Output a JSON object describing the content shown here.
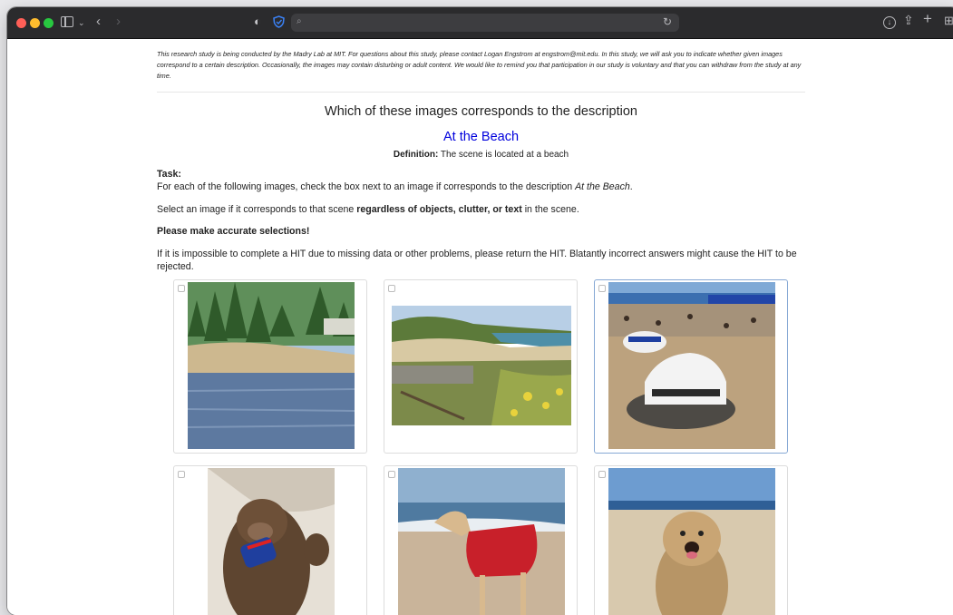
{
  "disclaimer": "This research study is being conducted by the Madry Lab at MIT. For questions about this study, please contact Logan Engstrom at engstrom@mit.edu. In this study, we will ask you to indicate whether given images correspond to a certain description. Occasionally, the images may contain disturbing or adult content. We would like to remind you that participation in our study is voluntary and that you can withdraw from the study at any time.",
  "question": "Which of these images corresponds to the description",
  "concept": "At the Beach",
  "definition": {
    "label": "Definition:",
    "text": "The scene is located at a beach"
  },
  "task": {
    "heading": "Task:",
    "line1_before": "For each of the following images, check the box next to an image if corresponds to the description ",
    "line1_italic": "At the Beach",
    "line1_after": ".",
    "line2_before": "Select an image if it corresponds to that scene ",
    "line2_bold": "regardless of objects, clutter, or text",
    "line2_after": " in the scene.",
    "accurate": "Please make accurate selections!",
    "hit_note": "If it is impossible to complete a HIT due to missing data or other problems, please return the HIT. Blatantly incorrect answers might cause the HIT to be rejected."
  },
  "images": [
    {
      "subject": "lake shore with pine trees",
      "checked": false
    },
    {
      "subject": "coastal cliff beach",
      "checked": false
    },
    {
      "subject": "race car on crowded beach",
      "checked": false,
      "highlighted": true
    },
    {
      "subject": "monkey with soda can",
      "checked": false
    },
    {
      "subject": "dog in red coat on beach",
      "checked": false
    },
    {
      "subject": "fluffy dog on beach",
      "checked": false
    }
  ],
  "colors": {
    "concept": "#0000dd",
    "selected_border": "#86a8d4"
  }
}
